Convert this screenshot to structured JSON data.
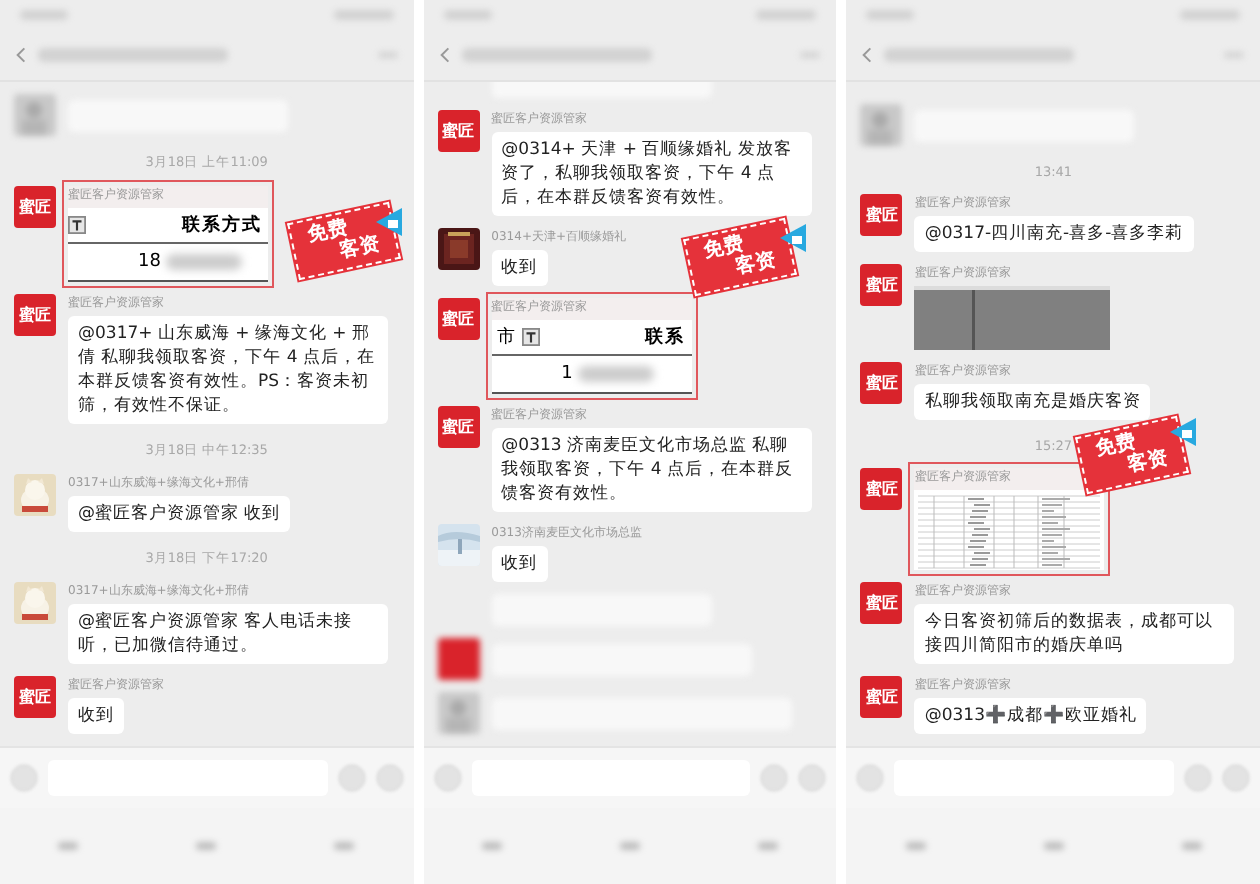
{
  "panels": [
    {
      "items": [
        {
          "kind": "blurred"
        },
        {
          "kind": "time",
          "text": "3月18日 上午11:09"
        },
        {
          "avatar": {
            "kind": "logo",
            "text": "蜜匠"
          },
          "sender": "蜜匠客户资源管家",
          "highlighted": true,
          "sticker": {
            "lines": [
              "免费",
              "客资"
            ]
          },
          "image": {
            "kind": "table",
            "header": [
              {
                "filter": true
              },
              {
                "text": "联系方式"
              }
            ],
            "value": "18"
          }
        },
        {
          "kind": "text",
          "avatar": {
            "kind": "logo",
            "text": "蜜匠"
          },
          "sender": "蜜匠客户资源管家",
          "text": "@0317+ 山东威海 + 缘海文化 + 邢倩 私聊我领取客资，下午 4 点后，在本群反馈客资有效性。PS：客资未初筛，有效性不保证。"
        },
        {
          "kind": "time",
          "text": "3月18日 中午12:35"
        },
        {
          "kind": "text",
          "avatar": {
            "kind": "cat"
          },
          "sender": "0317+山东威海+缘海文化+邢倩",
          "text": "@蜜匠客户资源管家  收到"
        },
        {
          "kind": "time",
          "text": "3月18日 下午17:20"
        },
        {
          "kind": "text",
          "avatar": {
            "kind": "cat"
          },
          "sender": "0317+山东威海+缘海文化+邢倩",
          "text": "@蜜匠客户资源管家  客人电话未接听，已加微信待通过。"
        },
        {
          "kind": "text",
          "avatar": {
            "kind": "logo",
            "text": "蜜匠"
          },
          "sender": "蜜匠客户资源管家",
          "text": "收到"
        }
      ]
    },
    {
      "items": [
        {
          "kind": "blurred"
        },
        {
          "kind": "text",
          "avatar": {
            "kind": "logo",
            "text": "蜜匠"
          },
          "sender": "蜜匠客户资源管家",
          "text": "@0314+ 天津 + 百顺缘婚礼 发放客资了，私聊我领取客资，下午 4 点后，在本群反馈客资有效性。"
        },
        {
          "kind": "text",
          "avatar": {
            "kind": "dark"
          },
          "sender": "0314+天津+百顺缘婚礼",
          "text": "收到"
        },
        {
          "avatar": {
            "kind": "logo",
            "text": "蜜匠"
          },
          "sender": "蜜匠客户资源管家",
          "highlighted": true,
          "sticker": {
            "lines": [
              "免费",
              "客资"
            ]
          },
          "image": {
            "kind": "table",
            "header": [
              {
                "text": "市",
                "filter": true
              },
              {
                "text": "联系"
              }
            ],
            "value": "1"
          }
        },
        {
          "kind": "text",
          "avatar": {
            "kind": "logo",
            "text": "蜜匠"
          },
          "sender": "蜜匠客户资源管家",
          "text": "@0313 济南麦臣文化市场总监 私聊我领取客资，下午 4 点后，在本群反馈客资有效性。"
        },
        {
          "kind": "text",
          "avatar": {
            "kind": "sky"
          },
          "sender": "0313济南麦臣文化市场总监",
          "text": "收到"
        },
        {
          "kind": "blurred"
        },
        {
          "kind": "blurred",
          "avatar": {
            "kind": "logo"
          }
        },
        {
          "kind": "blurred"
        }
      ]
    },
    {
      "items": [
        {
          "kind": "blurred"
        },
        {
          "kind": "time",
          "text": "13:41"
        },
        {
          "kind": "text",
          "avatar": {
            "kind": "logo",
            "text": "蜜匠"
          },
          "sender": "蜜匠客户资源管家",
          "text": "@0317-四川南充-喜多-喜多李莉"
        },
        {
          "avatar": {
            "kind": "logo",
            "text": "蜜匠"
          },
          "sender": "蜜匠客户资源管家",
          "highlighted": false,
          "image": {
            "kind": "gray"
          }
        },
        {
          "kind": "text",
          "avatar": {
            "kind": "logo",
            "text": "蜜匠"
          },
          "sender": "蜜匠客户资源管家",
          "text": "私聊我领取南充是婚庆客资"
        },
        {
          "kind": "time",
          "text": "15:27"
        },
        {
          "avatar": {
            "kind": "logo",
            "text": "蜜匠"
          },
          "sender": "蜜匠客户资源管家",
          "highlighted": true,
          "sticker": {
            "lines": [
              "免费",
              "客资"
            ]
          },
          "image": {
            "kind": "sheet"
          }
        },
        {
          "kind": "text",
          "avatar": {
            "kind": "logo",
            "text": "蜜匠"
          },
          "sender": "蜜匠客户资源管家",
          "text": "今日客资初筛后的数据表，成都可以接四川简阳市的婚庆单吗"
        },
        {
          "kind": "text",
          "avatar": {
            "kind": "logo",
            "text": "蜜匠"
          },
          "sender": "蜜匠客户资源管家",
          "text": "@0313➕成都➕欧亚婚礼"
        }
      ]
    }
  ]
}
